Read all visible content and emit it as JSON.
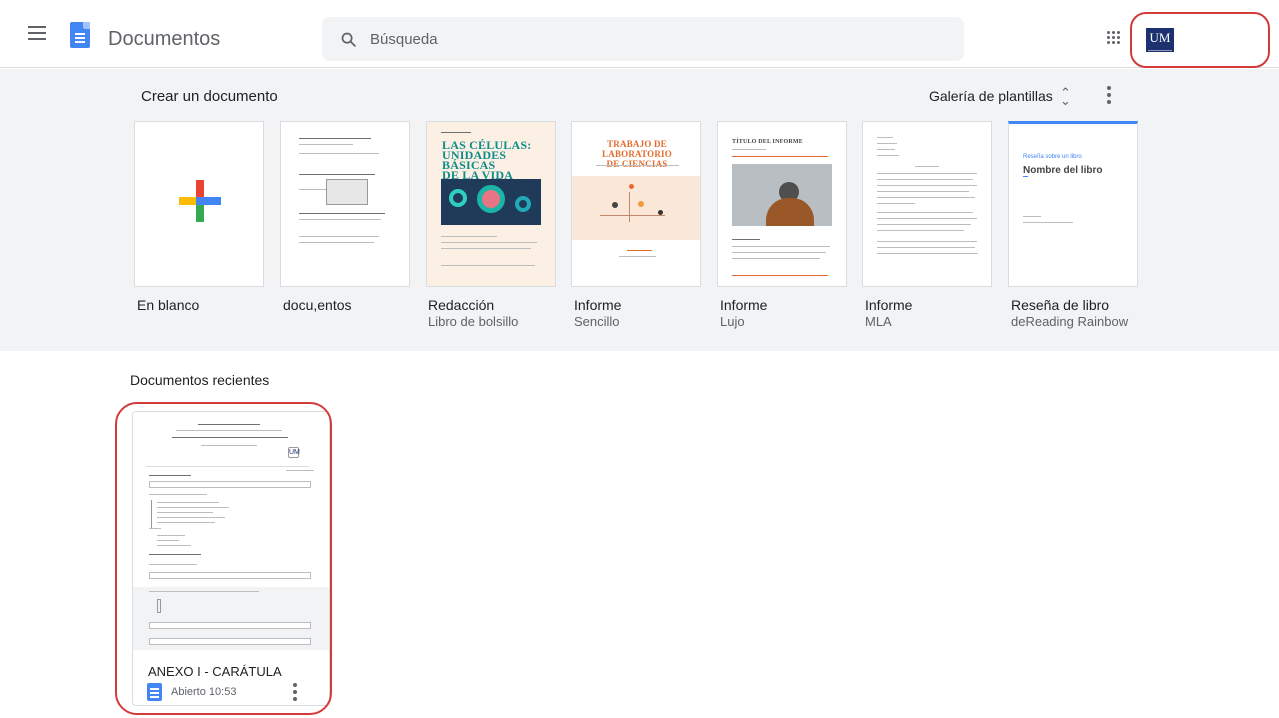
{
  "header": {
    "app_title": "Documentos",
    "search_placeholder": "Búsqueda",
    "account_logo_text": "UM"
  },
  "templates": {
    "section_title": "Crear un documento",
    "gallery_label": "Galería de plantillas",
    "items": [
      {
        "label": "En blanco",
        "subtitle": ""
      },
      {
        "label": "docu,entos",
        "subtitle": ""
      },
      {
        "label": "Redacción",
        "subtitle": "Libro de bolsillo"
      },
      {
        "label": "Informe",
        "subtitle": "Sencillo"
      },
      {
        "label": "Informe",
        "subtitle": "Lujo"
      },
      {
        "label": "Informe",
        "subtitle": "MLA"
      },
      {
        "label": "Reseña de libro",
        "subtitle": "deReading Rainbow"
      }
    ]
  },
  "thumbs": {
    "cells_title": "LAS CÉLULAS:\nUNIDADES BÁSICAS\nDE LA VIDA",
    "lab_title": "TRABAJO DE LABORATORIO\nDE CIENCIAS",
    "report_title": "TÍTULO DEL INFORME",
    "review_intro": "Reseña sobre un libro",
    "review_title": "Nombre del libro"
  },
  "recent": {
    "section_title": "Documentos recientes",
    "items": [
      {
        "name": "ANEXO I - CARÁTULA",
        "opened": "Abierto 10:53"
      }
    ]
  }
}
